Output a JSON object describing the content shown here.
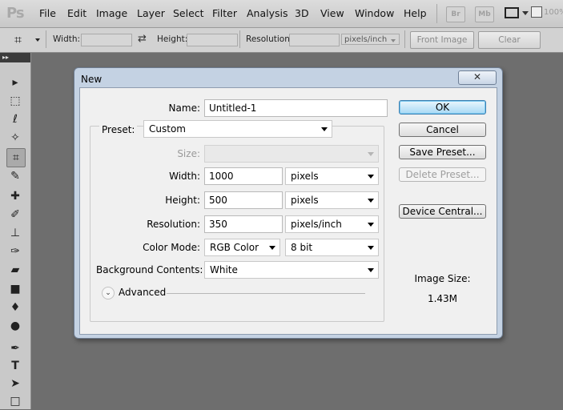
{
  "app": {
    "logo": "Ps"
  },
  "menu": [
    "File",
    "Edit",
    "Image",
    "Layer",
    "Select",
    "Filter",
    "Analysis",
    "3D",
    "View",
    "Window",
    "Help"
  ],
  "menubar_buttons": {
    "bridge": "Br",
    "mini_bridge": "Mb",
    "zoom": "100%"
  },
  "options_bar": {
    "width_label": "Width:",
    "height_label": "Height:",
    "resolution_label": "Resolution:",
    "resolution_unit": "pixels/inch",
    "front_image_label": "Front Image",
    "clear_label": "Clear"
  },
  "toolbox": {
    "collapse": "▸▸"
  },
  "dialog": {
    "title": "New",
    "close": "✕",
    "name_label": "Name:",
    "name_value": "Untitled-1",
    "preset_label": "Preset:",
    "preset_value": "Custom",
    "size_label": "Size:",
    "width_label": "Width:",
    "width_value": "1000",
    "width_unit": "pixels",
    "height_label": "Height:",
    "height_value": "500",
    "height_unit": "pixels",
    "resolution_label": "Resolution:",
    "resolution_value": "350",
    "resolution_unit": "pixels/inch",
    "color_mode_label": "Color Mode:",
    "color_mode_value": "RGB Color",
    "bit_depth_value": "8 bit",
    "background_label": "Background Contents:",
    "background_value": "White",
    "advanced_label": "Advanced",
    "ok_label": "OK",
    "cancel_label": "Cancel",
    "save_preset_label": "Save Preset...",
    "delete_preset_label": "Delete Preset...",
    "device_central_label": "Device Central...",
    "image_size_label": "Image Size:",
    "image_size_value": "1.43M"
  }
}
